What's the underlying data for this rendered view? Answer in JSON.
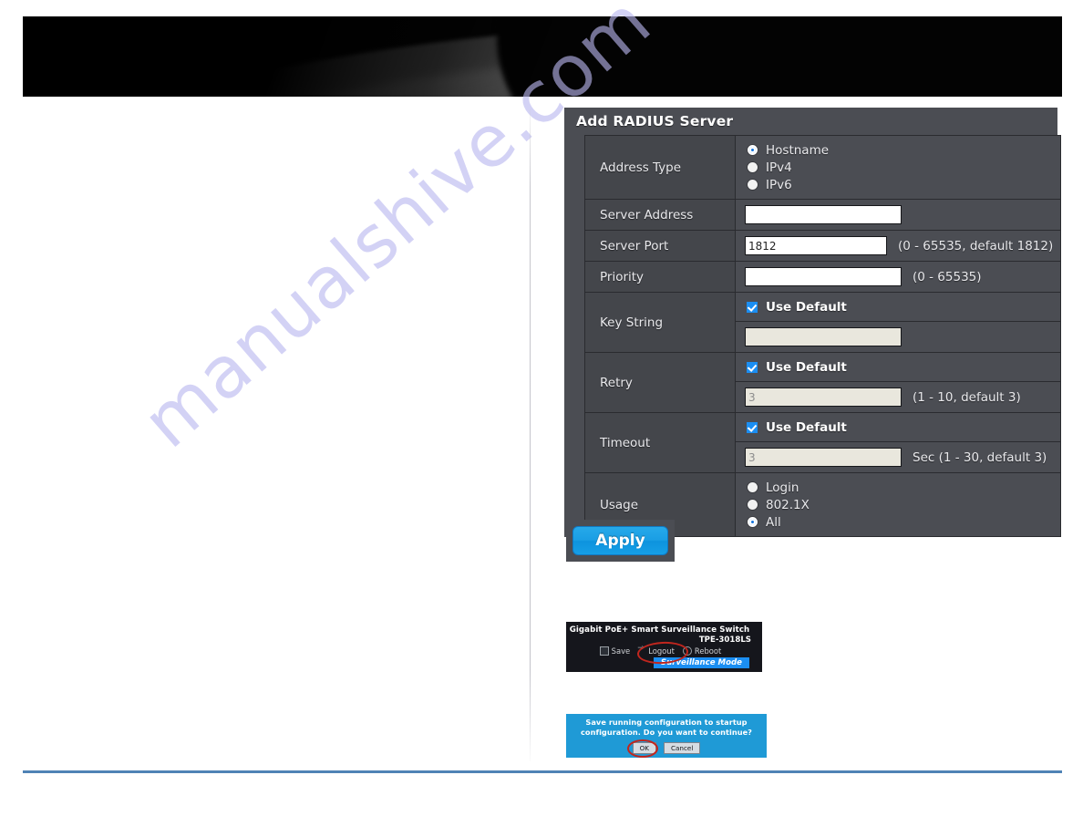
{
  "watermark": {
    "text": "manualshive.com"
  },
  "panel": {
    "title": "Add RADIUS Server",
    "rows": {
      "address_type": {
        "label": "Address Type",
        "options": [
          {
            "label": "Hostname",
            "selected": true
          },
          {
            "label": "IPv4",
            "selected": false
          },
          {
            "label": "IPv6",
            "selected": false
          }
        ]
      },
      "server_address": {
        "label": "Server Address",
        "value": "",
        "placeholder": ""
      },
      "server_port": {
        "label": "Server Port",
        "value": "1812",
        "hint": "(0 - 65535, default 1812)"
      },
      "priority": {
        "label": "Priority",
        "value": "",
        "hint": "(0 - 65535)"
      },
      "key_string": {
        "label": "Key String",
        "use_default_label": "Use Default",
        "use_default_checked": true,
        "value": ""
      },
      "retry": {
        "label": "Retry",
        "use_default_label": "Use Default",
        "use_default_checked": true,
        "value": "3",
        "hint": "(1 - 10, default 3)"
      },
      "timeout": {
        "label": "Timeout",
        "use_default_label": "Use Default",
        "use_default_checked": true,
        "value": "3",
        "hint": "Sec (1 - 30, default 3)"
      },
      "usage": {
        "label": "Usage",
        "options": [
          {
            "label": "Login",
            "selected": false
          },
          {
            "label": "802.1X",
            "selected": false
          },
          {
            "label": "All",
            "selected": true
          }
        ]
      }
    }
  },
  "apply": {
    "label": "Apply"
  },
  "device_banner": {
    "product_name": "Gigabit PoE+ Smart Surveillance Switch",
    "model": "TPE-3018LS",
    "links": [
      {
        "label": "Save",
        "icon": "save-icon"
      },
      {
        "label": "Logout",
        "icon": "logout-arrow-icon"
      },
      {
        "label": "Reboot",
        "icon": "reboot-icon"
      }
    ],
    "mode_badge": "Surveillance Mode"
  },
  "confirm_dialog": {
    "message": "Save running configuration to startup configuration. Do you want to continue?",
    "ok_label": "OK",
    "cancel_label": "Cancel"
  },
  "colors": {
    "panel_bg": "#4b4d53",
    "label_bg": "#44464b",
    "accent_blue": "#1b8ef2",
    "apply_blue": "#1a9ee4",
    "footer_rule": "#4f83b5",
    "highlight_red": "#c0261e",
    "watermark": "#b9b7ef"
  }
}
